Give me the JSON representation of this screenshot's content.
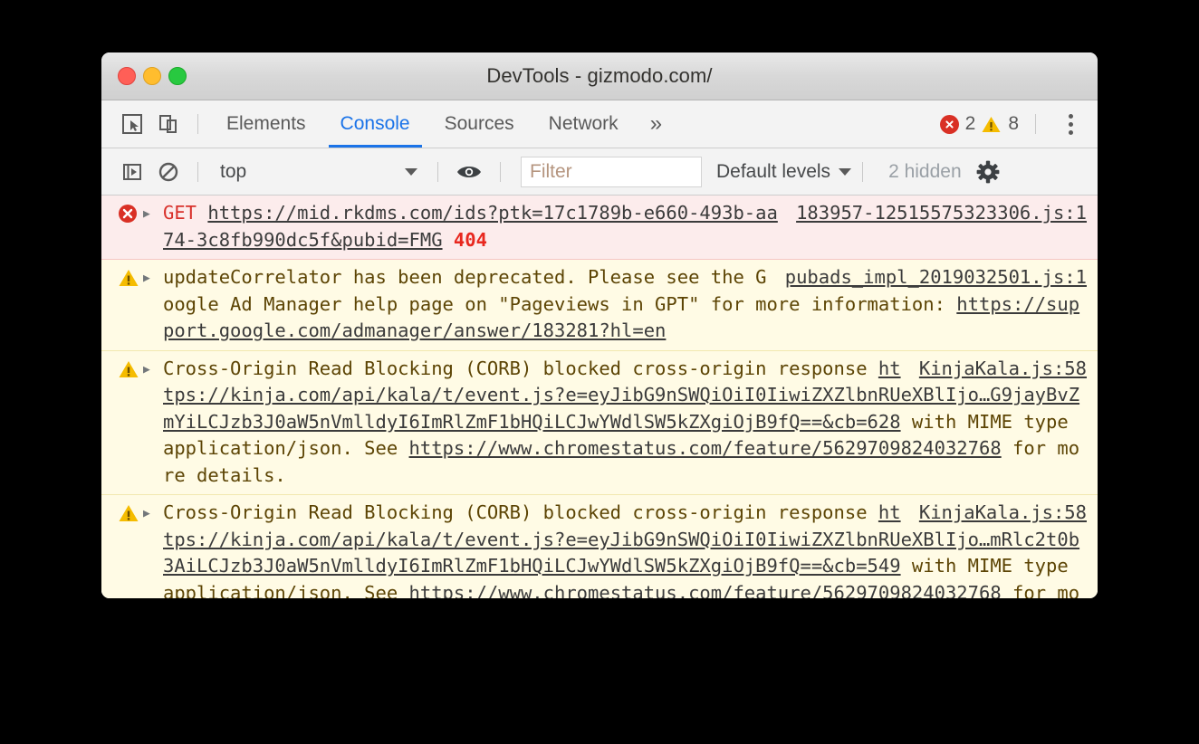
{
  "window": {
    "title": "DevTools - gizmodo.com/",
    "traffic_lights": [
      "close-button",
      "minimize-button",
      "zoom-button"
    ]
  },
  "tabbar": {
    "icons": [
      "inspect-element-icon",
      "device-toolbar-icon"
    ],
    "tabs": [
      {
        "label": "Elements",
        "active": false
      },
      {
        "label": "Console",
        "active": true
      },
      {
        "label": "Sources",
        "active": false
      },
      {
        "label": "Network",
        "active": false
      }
    ],
    "overflow_label": "»",
    "error_count": "2",
    "warning_count": "8",
    "more_options": "kebab-menu-icon"
  },
  "filterbar": {
    "execute_icon": "execute-snippet-icon",
    "clear_icon": "clear-console-icon",
    "context_value": "top",
    "eye_icon": "live-expression-icon",
    "filter_placeholder": "Filter",
    "filter_value": "",
    "levels_label": "Default levels",
    "hidden_label": "2 hidden",
    "settings_icon": "gear-icon"
  },
  "console": {
    "messages": [
      {
        "level": "error",
        "icon": "error-icon",
        "anchor": "183957-12515575323306.js:1",
        "method": "GET",
        "url": "https://mid.rkdms.com/ids?ptk=17c1789b-e660-493b-aa74-3c8fb990dc5f&pubid=FMG",
        "status": "404"
      },
      {
        "level": "warning",
        "icon": "warning-icon",
        "anchor": "pubads_impl_2019032501.js:1",
        "text_a": "updateCorrelator has been deprecated. Please see the Google Ad Manager help page on \"Pageviews in GPT\" for more information: ",
        "link_a": "https://support.google.com/admanager/answer/183281?hl=en",
        "text_b": ""
      },
      {
        "level": "warning",
        "icon": "warning-icon",
        "anchor": "KinjaKala.js:58",
        "text_a": "Cross-Origin Read Blocking (CORB) blocked cross-origin response ",
        "link_a": "https://kinja.com/api/kala/t/event.js?e=eyJibG9nSWQiOiI0IiwiZXZlbnRUeXBlIjo…G9jayBvZmYiLCJzb3J0aW5nVmlldyI6ImRlZmF1bHQiLCJwYWdlSW5kZXgiOjB9fQ==&cb=628",
        "text_b": " with MIME type application/json. See ",
        "link_b": "https://www.chromestatus.com/feature/5629709824032768",
        "text_c": " for more details."
      },
      {
        "level": "warning",
        "icon": "warning-icon",
        "anchor": "KinjaKala.js:58",
        "text_a": "Cross-Origin Read Blocking (CORB) blocked cross-origin response ",
        "link_a": "https://kinja.com/api/kala/t/event.js?e=eyJibG9nSWQiOiI0IiwiZXZlbnRUeXBlIjo…mRlc2t0b3AiLCJzb3J0aW5nVmlldyI6ImRlZmF1bHQiLCJwYWdlSW5kZXgiOjB9fQ==&cb=549",
        "text_b": " with MIME type application/json. See ",
        "link_b": "https://www.chromestatus.com/feature/5629709824032768",
        "text_c": " for more details."
      }
    ]
  },
  "colors": {
    "accent": "#1a73e8",
    "error_red": "#d93025",
    "warning_yellow": "#f5bc00",
    "error_bg": "#fcecec",
    "warning_bg": "#fffbe5"
  }
}
